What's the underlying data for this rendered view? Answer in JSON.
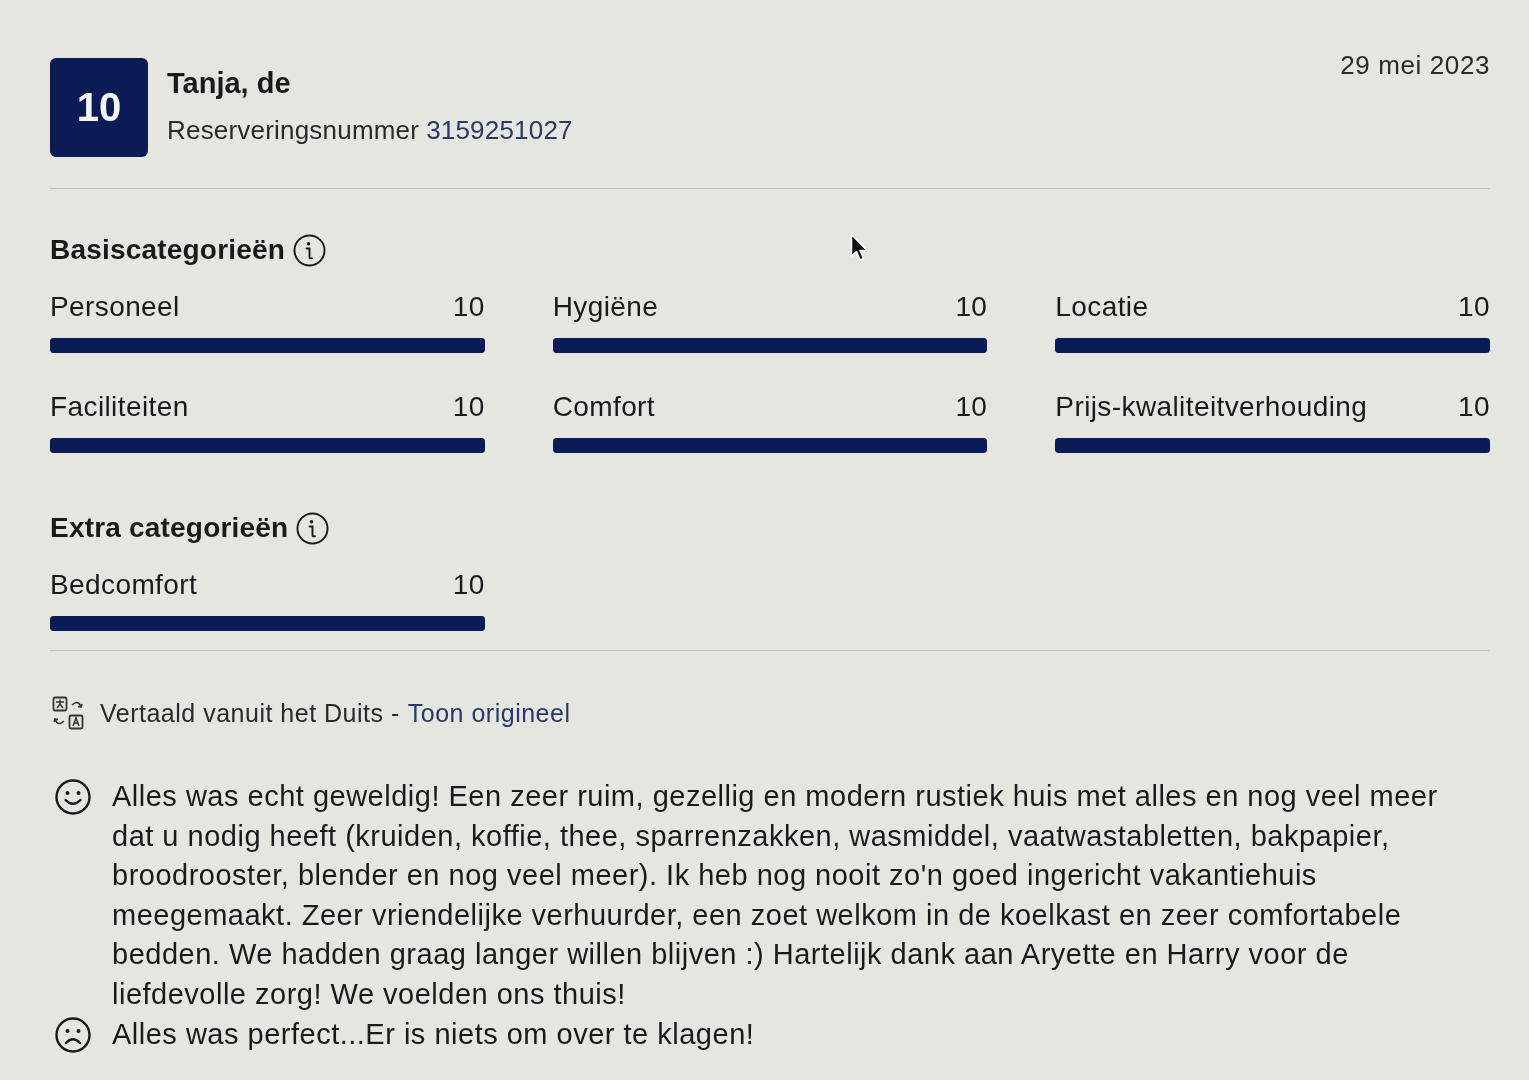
{
  "review": {
    "score": "10",
    "reviewer": "Tanja, de",
    "reservation_label": "Reserveringsnummer",
    "reservation_number": "3159251027",
    "date": "29 mei 2023"
  },
  "category_groups": [
    {
      "title": "Basiscategorieën",
      "items": [
        {
          "label": "Personeel",
          "score": "10",
          "level": 1
        },
        {
          "label": "Hygiëne",
          "score": "10",
          "level": 1
        },
        {
          "label": "Locatie",
          "score": "10",
          "level": 1
        },
        {
          "label": "Faciliteiten",
          "score": "10",
          "level": 1
        },
        {
          "label": "Comfort",
          "score": "10",
          "level": 1
        },
        {
          "label": "Prijs-kwaliteitverhouding",
          "score": "10",
          "level": 1
        }
      ]
    },
    {
      "title": "Extra categorieën",
      "items": [
        {
          "label": "Bedcomfort",
          "score": "10",
          "level": 1
        }
      ]
    }
  ],
  "translation": {
    "note": "Vertaald vanuit het Duits -",
    "link": "Toon origineel"
  },
  "comments": [
    {
      "kind": "positive",
      "text": "Alles was echt geweldig! Een zeer ruim, gezellig en modern rustiek huis met alles en nog veel meer dat u nodig heeft (kruiden, koffie, thee, sparrenzakken, wasmiddel, vaatwastabletten, bakpapier, broodrooster, blender en nog veel meer). Ik heb nog nooit zo'n goed ingericht vakantiehuis meegemaakt. Zeer vriendelijke verhuurder, een zoet welkom in de koelkast en zeer comfortabele bedden. We hadden graag langer willen blijven :) Hartelijk dank aan Aryette en Harry voor de liefdevolle zorg! We voelden ons thuis!"
    },
    {
      "kind": "negative",
      "text": "Alles was perfect...Er is niets om over te klagen!"
    }
  ]
}
